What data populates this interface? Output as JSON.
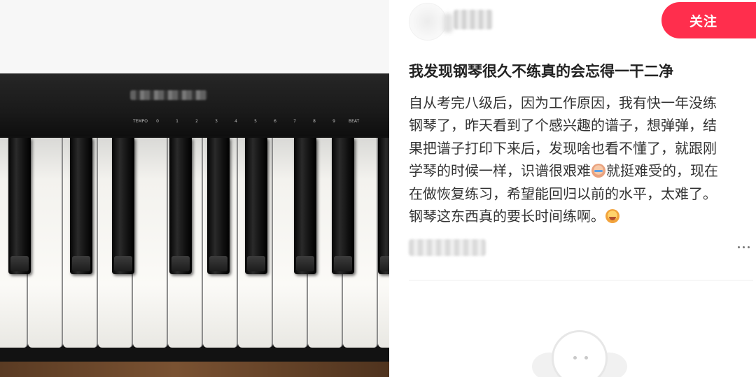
{
  "post": {
    "follow_label": "关注",
    "title": "我发现钢琴很久不练真的会忘得一干二净",
    "body_lines": [
      "自从考完八级后，因为工作原因，我有快一年没练",
      "钢琴了，昨天看到了个感兴趣的谱子，想弹弹，结",
      "果把谱子打印下来后，发现啥也看不懂了，就跟刚",
      "学琴的时候一样，识谱很艰难",
      "就挺难受的，现在",
      "在做恢复练习，希望能回归以前的水平，太难了。",
      "钢琴这东西真的要长时间练啊。"
    ],
    "emoji_1": "crying-emoji-icon",
    "emoji_2": "laughing-emoji-icon"
  },
  "colors": {
    "accent": "#ff2e4d",
    "title_text": "#222222",
    "body_text": "#333333"
  },
  "photo": {
    "subject": "piano-keyboard-photo",
    "panel_labels": [
      "TEMPO",
      "0",
      "1",
      "2",
      "3",
      "4",
      "5",
      "6",
      "7",
      "8",
      "9",
      "BEAT"
    ]
  }
}
